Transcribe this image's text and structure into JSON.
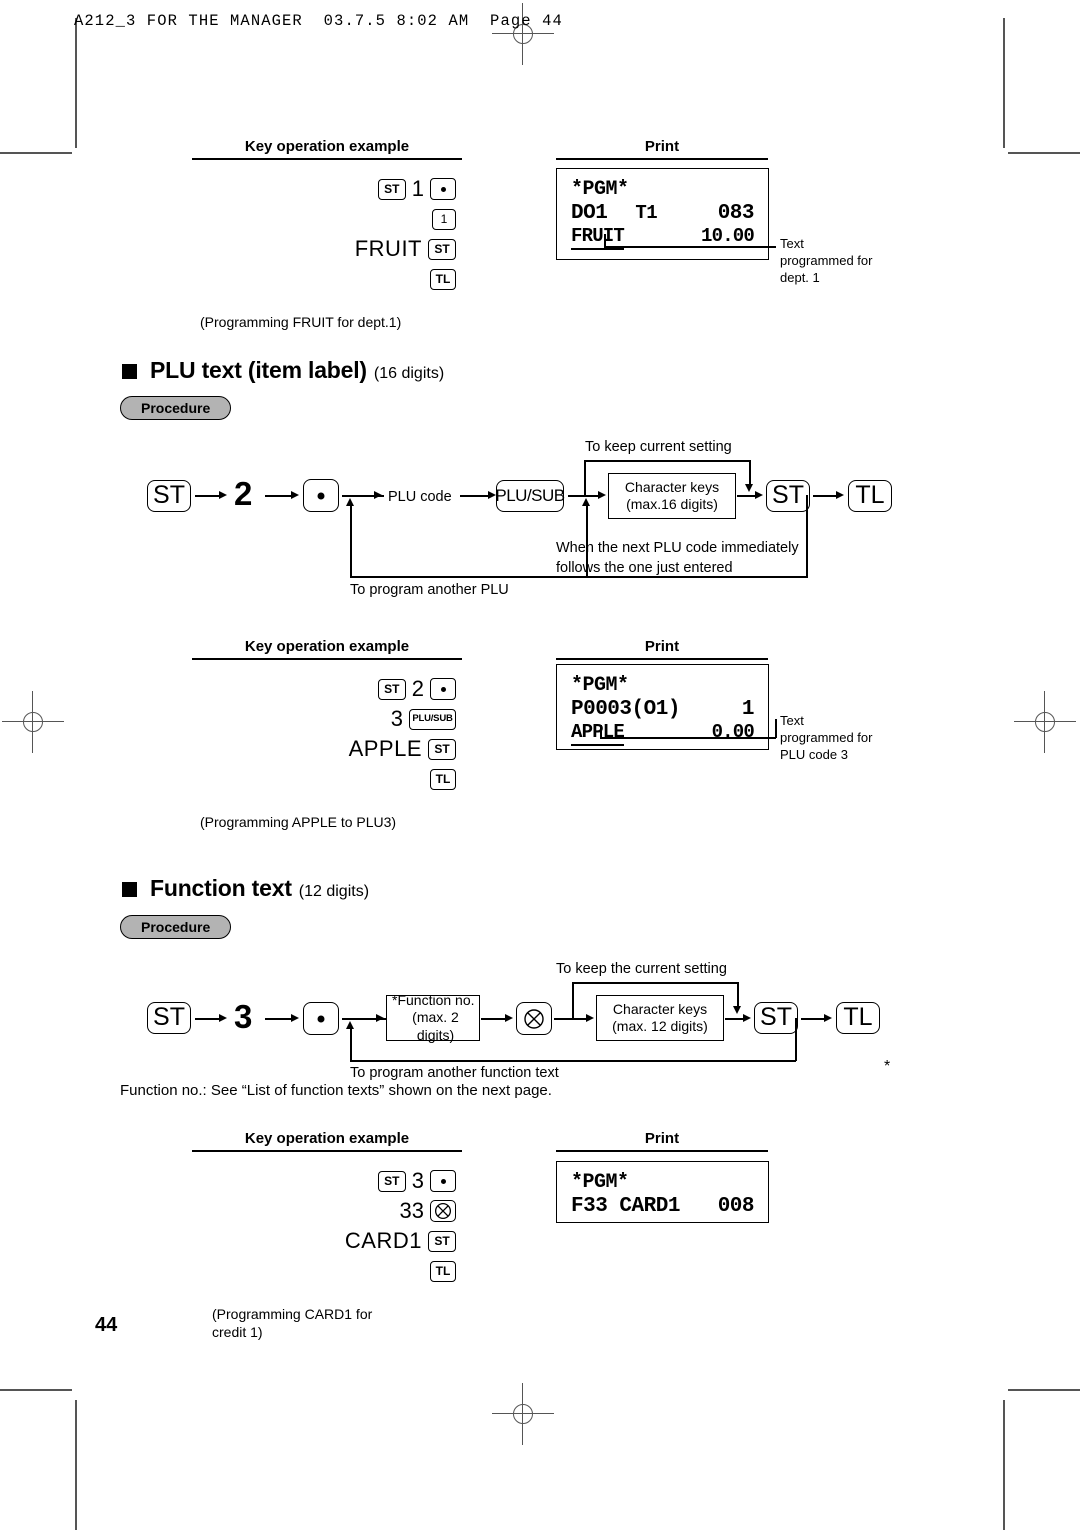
{
  "page": {
    "header": "A212_3 FOR THE MANAGER  03.7.5 8:02 AM  Page 44",
    "number": "44"
  },
  "column_headers": {
    "key_operation": "Key operation example",
    "print": "Print"
  },
  "keycaps": {
    "st": "ST",
    "tl": "TL",
    "plusub": "PLU/SUB",
    "one": "1"
  },
  "example_dept": {
    "rows": [
      {
        "digit": "1"
      },
      {
        "digit": "1"
      },
      {
        "word": "FRUIT"
      },
      {
        "word": ""
      }
    ],
    "caption": "(Programming FRUIT for dept.1)",
    "receipt": {
      "title": "*PGM*",
      "line2_left": "DO1",
      "line2_mid": "T1",
      "line2_right": "083",
      "line3_left": "FRUIT",
      "line3_right": "10.00"
    },
    "callout": "Text\nprogrammed for\ndept. 1"
  },
  "section_plu": {
    "title": "PLU text (item label)",
    "subtitle": "(16 digits)",
    "procedure_label": "Procedure",
    "flow": {
      "step_st": "ST",
      "step_num": "2",
      "plu_code": "PLU code",
      "plusub": "PLU/SUB",
      "char_keys": "Character keys\n(max.16 digits)",
      "char_keys_l1": "Character keys",
      "char_keys_l2": "(max.16 digits)",
      "end_st": "ST",
      "end_tl": "TL",
      "note_keep": "To keep current setting",
      "note_next_l1": "When the next PLU code immediately",
      "note_next_l2": "follows the one just entered",
      "note_another": "To program another PLU"
    }
  },
  "example_plu": {
    "rows": [
      {
        "digit": "2"
      },
      {
        "digit": "3"
      },
      {
        "word": "APPLE"
      },
      {
        "word": ""
      }
    ],
    "caption": "(Programming APPLE to PLU3)",
    "receipt": {
      "title": "*PGM*",
      "line2_left": "P0003(O1)",
      "line2_right": "1",
      "line3_left": "APPLE",
      "line3_right": "0.00"
    },
    "callout": "Text\nprogrammed for\nPLU code 3"
  },
  "section_function": {
    "title": "Function text",
    "subtitle": "(12 digits)",
    "procedure_label": "Procedure",
    "flow": {
      "step_st": "ST",
      "step_num": "3",
      "func_no_l1": "*Function no.",
      "func_no_l2": "(max. 2 digits)",
      "multiply_icon": "multiply-key",
      "char_keys_l1": "Character keys",
      "char_keys_l2": "(max. 12 digits)",
      "end_st": "ST",
      "end_tl": "TL",
      "note_keep": "To keep the current setting",
      "note_another": "To program another function text",
      "asterisk": "*"
    },
    "note": "Function no.: See “List of function texts” shown on the next page."
  },
  "example_function": {
    "rows": [
      {
        "digit": "3"
      },
      {
        "digit": "33"
      },
      {
        "word": "CARD1"
      },
      {
        "word": ""
      }
    ],
    "caption_l1": "(Programming CARD1 for",
    "caption_l2": "credit 1)",
    "receipt": {
      "title": "*PGM*",
      "line2_left": "F33 CARD1",
      "line2_right": "008"
    }
  }
}
